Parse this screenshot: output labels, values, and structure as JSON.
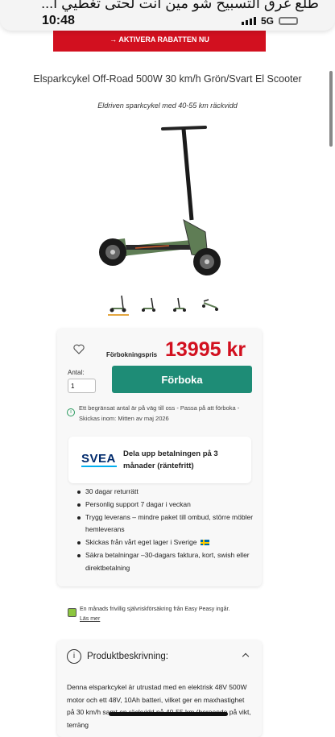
{
  "notification": {
    "text": "طلع غرق التسبيح شو مين انت لحتى تغطيي ا..."
  },
  "status_bar": {
    "time": "10:48",
    "network": "5G"
  },
  "promo_banner": {
    "label": "→ AKTIVERA RABATTEN NU"
  },
  "product": {
    "title": "Elsparkcykel Off-Road 500W 30 km/h Grön/Svart El Scooter",
    "subtitle": "Eldriven sparkcykel med 40-55 km räckvidd",
    "thumbnails": [
      "scooter-front",
      "scooter-side",
      "scooter-folded",
      "scooter-angled"
    ],
    "selected_thumbnail": 0
  },
  "purchase": {
    "price_label": "Förbokningspris",
    "price": "13995 kr",
    "quantity_label": "Antal:",
    "quantity_value": "1",
    "prebook_button": "Förboka",
    "availability_text": "Ett begränsat antal är på väg till oss - Passa på att förboka - Skickas inom: Mitten av maj 2026"
  },
  "svea": {
    "logo": "SVEA",
    "text": "Dela upp betalningen på 3 månader (räntefritt)"
  },
  "usps": [
    "30 dagar returrätt",
    "Personlig support 7 dagar i veckan",
    "Trygg leverans – mindre paket till ombud, större möbler hemleverans",
    "Skickas från vårt eget lager i Sverige",
    "Säkra betalningar –30-dagars faktura, kort, swish eller direktbetalning"
  ],
  "insurance": {
    "text": "En månads frivillig självriskförsäkring från Easy Peasy ingår.",
    "link": "Läs mer"
  },
  "description": {
    "title": "Produktbeskrivning:",
    "text": "Denna elsparkcykel är utrustad med en elektrisk 48V 500W motor och ett 48V, 10Ah batteri, vilket ger en maxhastighet på 30 km/h samt en räckvidd på 40-55 km (beroende på vikt, terräng"
  },
  "colors": {
    "brand_red": "#d2101f",
    "cta_green": "#1e8c76",
    "scooter_green": "#5f7d55"
  }
}
